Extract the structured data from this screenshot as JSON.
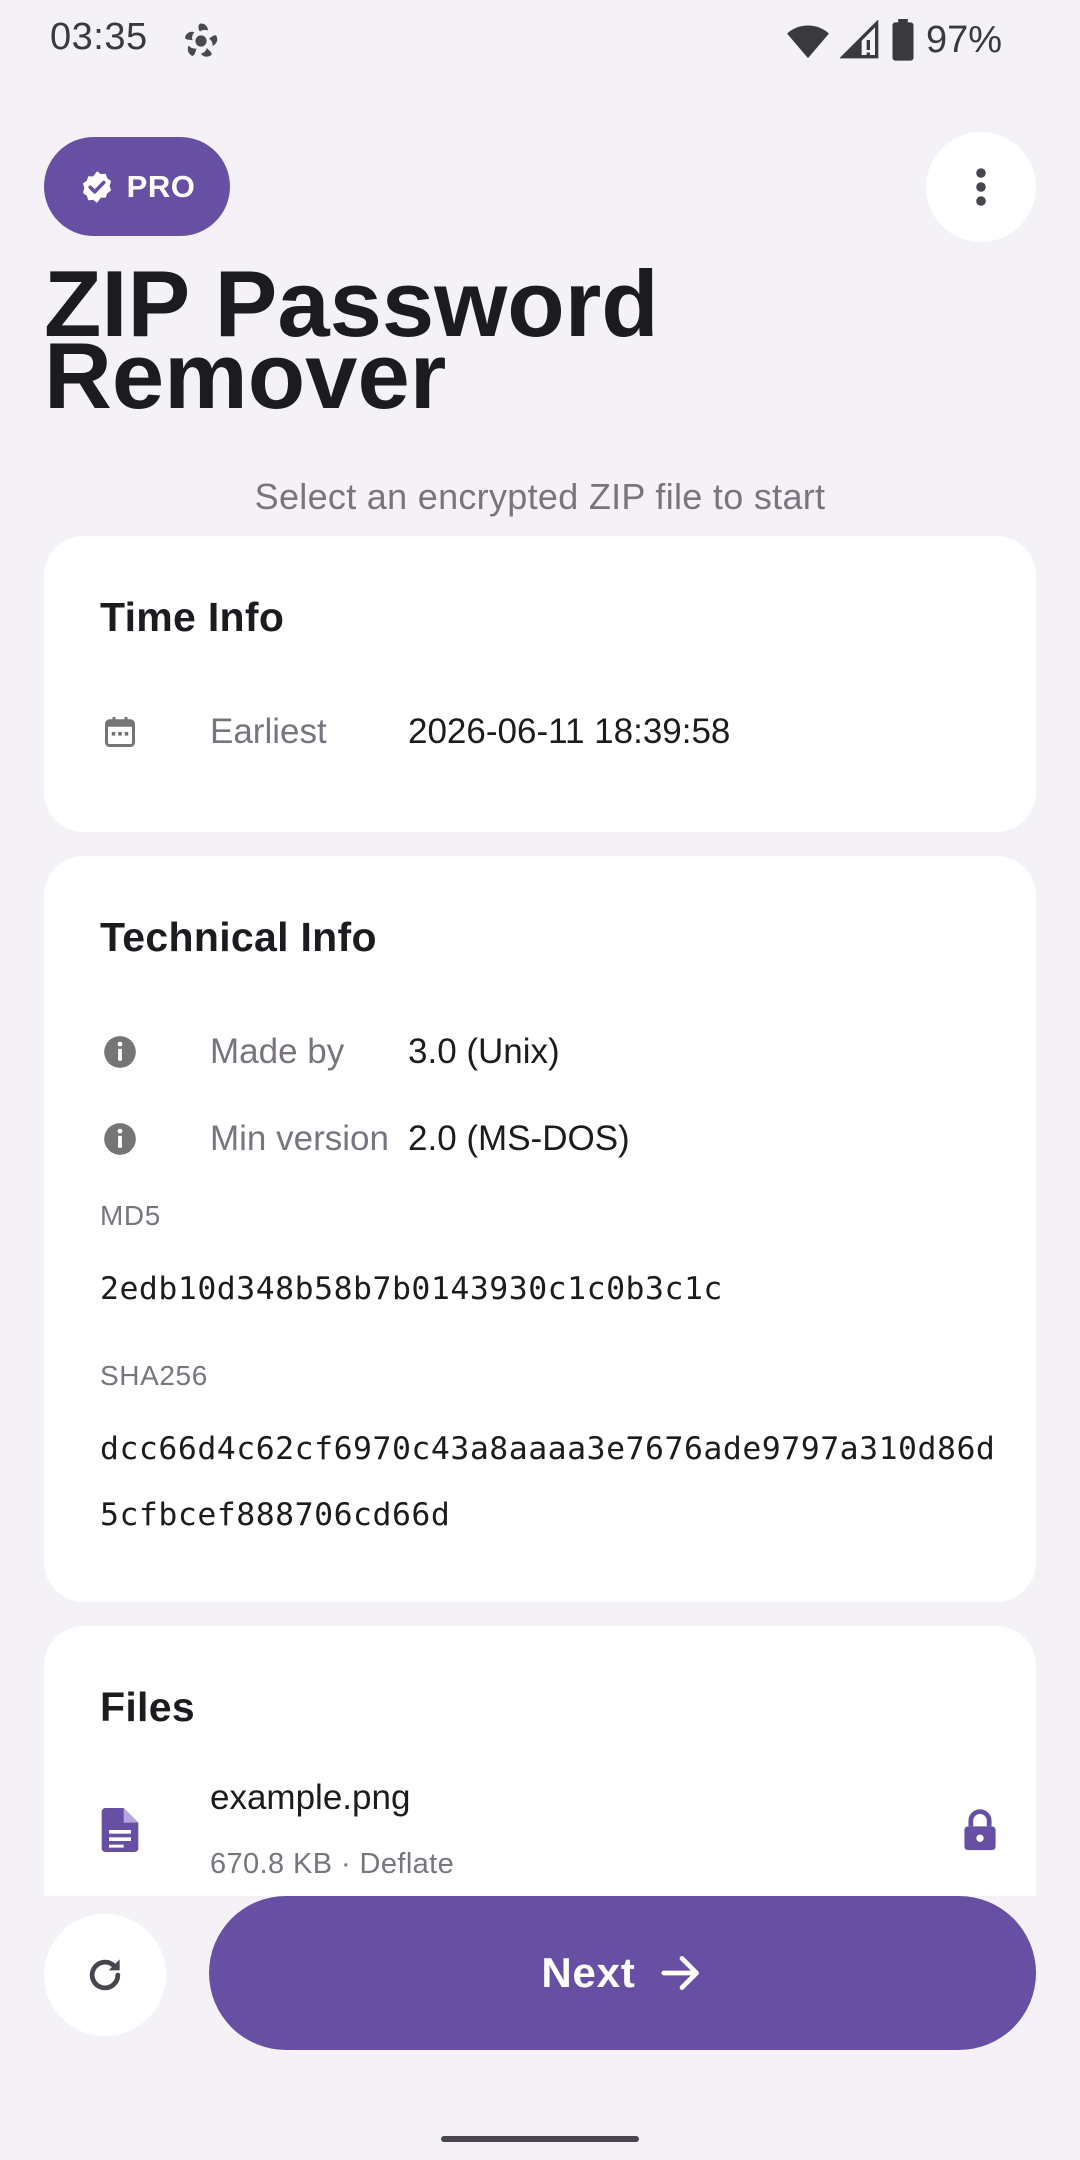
{
  "status_bar": {
    "time": "03:35",
    "battery": "97%"
  },
  "header": {
    "pro_label": "PRO",
    "title": "ZIP Password Remover",
    "subtitle": "Select an encrypted ZIP file to start"
  },
  "time_info": {
    "title": "Time Info",
    "rows": [
      {
        "label": "Earliest",
        "value": "2026-06-11 18:39:58",
        "icon": "calendar-icon"
      }
    ]
  },
  "technical_info": {
    "title": "Technical Info",
    "rows": [
      {
        "label": "Made by",
        "value": "3.0 (Unix)",
        "icon": "info-icon"
      },
      {
        "label": "Min version",
        "value": "2.0 (MS-DOS)",
        "icon": "info-icon"
      }
    ],
    "md5_label": "MD5",
    "md5_value": "2edb10d348b58b7b0143930c1c0b3c1c",
    "sha256_label": "SHA256",
    "sha256_value": "dcc66d4c62cf6970c43a8aaaa3e7676ade9797a310d86d5cfbcef888706cd66d"
  },
  "files": {
    "title": "Files",
    "items": [
      {
        "name": "example.png",
        "meta": "670.8 KB · Deflate",
        "icon": "file-icon",
        "locked": true
      }
    ]
  },
  "bottom_bar": {
    "next_label": "Next"
  },
  "colors": {
    "accent": "#6750a4",
    "background": "#f4f2f6",
    "card": "#ffffff",
    "muted_text": "#79747e"
  }
}
